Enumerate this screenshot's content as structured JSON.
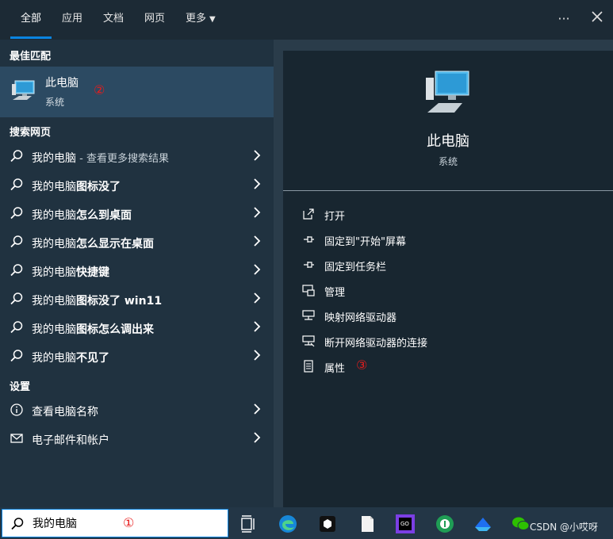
{
  "tabs": [
    {
      "label": "全部",
      "active": true
    },
    {
      "label": "应用"
    },
    {
      "label": "文档"
    },
    {
      "label": "网页"
    },
    {
      "label": "更多"
    }
  ],
  "top_icons": {
    "more": "ellipsis-icon",
    "close": "close-icon"
  },
  "best_match": {
    "section_title": "最佳匹配",
    "name": "此电脑",
    "type": "系统",
    "annotation": "②"
  },
  "web": {
    "section_title": "搜索网页",
    "items": [
      {
        "main": "我的电脑",
        "sub": " - 查看更多搜索结果"
      },
      {
        "main": "我的电脑",
        "bold": "图标没了"
      },
      {
        "main": "我的电脑",
        "bold": "怎么到桌面"
      },
      {
        "main": "我的电脑",
        "bold": "怎么显示在桌面"
      },
      {
        "main": "我的电脑",
        "bold": "快捷键"
      },
      {
        "main": "我的电脑",
        "bold": "图标没了 win11"
      },
      {
        "main": "我的电脑",
        "bold": "图标怎么调出来"
      },
      {
        "main": "我的电脑",
        "bold": "不见了"
      }
    ]
  },
  "settings": {
    "section_title": "设置",
    "items": [
      {
        "label": "查看电脑名称",
        "icon": "info-icon"
      },
      {
        "label": "电子邮件和帐户",
        "icon": "mail-icon"
      }
    ]
  },
  "preview": {
    "name": "此电脑",
    "type": "系统",
    "actions": [
      {
        "label": "打开",
        "icon": "open-icon"
      },
      {
        "label": "固定到\"开始\"屏幕",
        "icon": "pin-icon"
      },
      {
        "label": "固定到任务栏",
        "icon": "pin-icon"
      },
      {
        "label": "管理",
        "icon": "manage-icon"
      },
      {
        "label": "映射网络驱动器",
        "icon": "network-drive-icon"
      },
      {
        "label": "断开网络驱动器的连接",
        "icon": "network-drive-icon"
      },
      {
        "label": "属性",
        "icon": "properties-icon",
        "annotation": "③"
      }
    ]
  },
  "search": {
    "value": "我的电脑",
    "annotation": "①"
  },
  "taskbar": {
    "watermark": "CSDN @小哎呀"
  },
  "colors": {
    "accent": "#0a84e0",
    "annotation": "#e81c1c"
  }
}
